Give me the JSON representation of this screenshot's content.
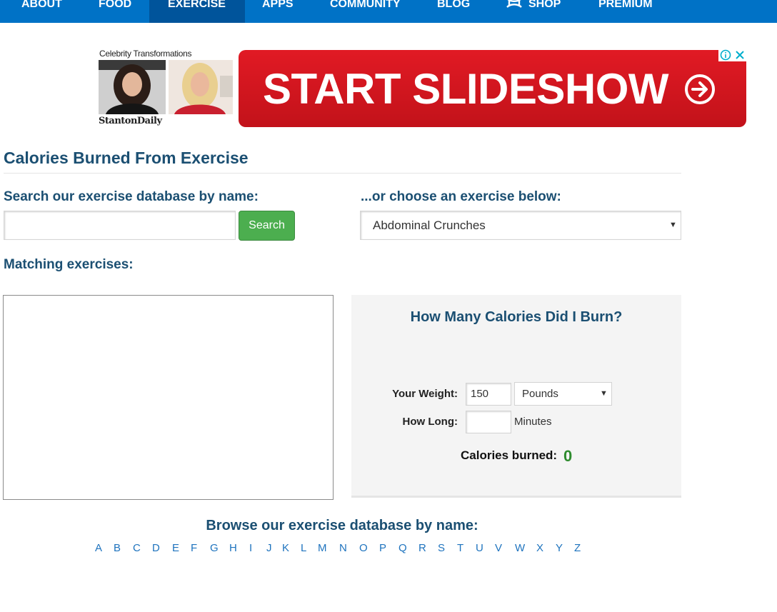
{
  "nav": {
    "items": [
      {
        "label": "ABOUT"
      },
      {
        "label": "FOOD"
      },
      {
        "label": "EXERCISE"
      },
      {
        "label": "APPS"
      },
      {
        "label": "COMMUNITY"
      },
      {
        "label": "BLOG"
      },
      {
        "label": "SHOP",
        "icon": "under-armour-logo-icon"
      },
      {
        "label": "PREMIUM"
      }
    ],
    "active": "EXERCISE",
    "background": "#0072c6",
    "active_background": "#00549b"
  },
  "ad": {
    "thumb_title": "Celebrity Transformations",
    "brand": "StantonDaily",
    "banner_label": "START SLIDESHOW",
    "banner_color": "#d9161f",
    "icons": [
      "arrow-circle-right-icon",
      "adchoices-info-icon",
      "close-icon"
    ]
  },
  "page": {
    "title": "Calories Burned From Exercise"
  },
  "search": {
    "label": "Search our exercise database by name:",
    "input_value": "",
    "button_label": "Search",
    "button_color": "#4cae4f"
  },
  "choose": {
    "label": "...or choose an exercise below:",
    "selected": "Abdominal Crunches"
  },
  "matching": {
    "label": "Matching exercises:"
  },
  "calculator": {
    "title": "How Many Calories Did I Burn?",
    "weight_label": "Your Weight:",
    "weight_value": "150",
    "unit_selected": "Pounds",
    "duration_label": "How Long:",
    "duration_value": "",
    "duration_unit": "Minutes",
    "burned_label": "Calories burned:",
    "burned_value": "0",
    "burned_color": "#2e8b2e"
  },
  "browse": {
    "title": "Browse our exercise database by name:",
    "letters": [
      "A",
      "B",
      "C",
      "D",
      "E",
      "F",
      "G",
      "H",
      "I",
      "J",
      "K",
      "L",
      "M",
      "N",
      "O",
      "P",
      "Q",
      "R",
      "S",
      "T",
      "U",
      "V",
      "W",
      "X",
      "Y",
      "Z"
    ]
  }
}
